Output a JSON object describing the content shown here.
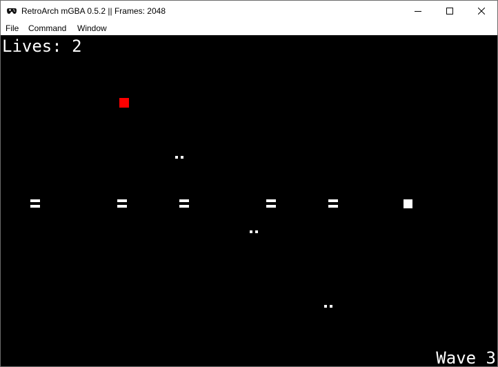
{
  "window": {
    "title": "RetroArch mGBA 0.5.2 || Frames: 2048",
    "app_icon": "gamepad-icon",
    "controls": [
      "minimize-icon",
      "maximize-icon",
      "close-icon"
    ]
  },
  "menu": {
    "file": "File",
    "command": "Command",
    "window": "Window"
  },
  "game": {
    "lives_text": "Lives: 2",
    "wave_text": "Wave 3",
    "background_color": "#000000",
    "player_color": "#ff0000",
    "sprite_color": "#ffffff",
    "enemy_count": 5,
    "bullet_count": 3,
    "powerup_count": 1
  }
}
